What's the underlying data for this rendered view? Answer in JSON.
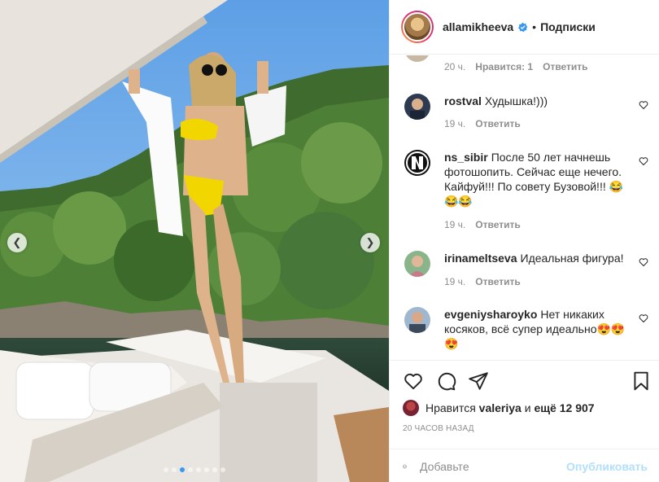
{
  "header": {
    "username": "allamikheeva",
    "separator": "•",
    "follow_label": "Подписки"
  },
  "prev_comment_meta": {
    "time": "20 ч.",
    "likes": "Нравится: 1",
    "reply": "Ответить"
  },
  "comments": [
    {
      "username": "rostval",
      "text": "Худышка!)))",
      "time": "19 ч.",
      "reply": "Ответить"
    },
    {
      "username": "ns_sibir",
      "text": "После 50 лет начнешь фотошопить. Сейчас еще нечего. Кайфуй!!! По совету Бузовой!!! 😂😂😂",
      "time": "19 ч.",
      "reply": "Ответить"
    },
    {
      "username": "irinameltseva",
      "text": "Идеальная фигура!",
      "time": "19 ч.",
      "reply": "Ответить"
    },
    {
      "username": "evgeniysharoyko",
      "text": "Нет никаких косяков, всё супер идеально😍😍😍"
    }
  ],
  "likes": {
    "prefix": "Нравится",
    "user": "valeriya",
    "connector": "и",
    "count": "ещё 12 907"
  },
  "time_ago": "20 ЧАСОВ НАЗАД",
  "add_comment": {
    "placeholder": "Добавьте",
    "publish_label": "Опубликовать"
  },
  "carousel": {
    "slide_count": 8,
    "active_index": 2
  },
  "colors": {
    "accent": "#3897f0",
    "publish_disabled": "#b2dffc",
    "muted": "#8e8e8e"
  },
  "icons": {
    "prev": "chevron-left-icon",
    "next": "chevron-right-icon",
    "like": "heart-icon",
    "comment": "comment-icon",
    "share": "paper-plane-icon",
    "save": "bookmark-icon",
    "emoji": "smiley-icon"
  }
}
